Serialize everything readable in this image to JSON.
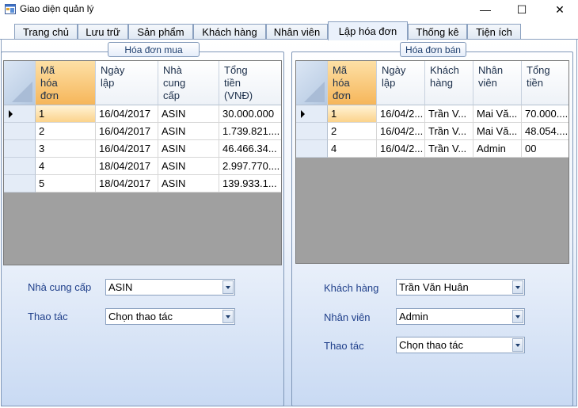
{
  "window": {
    "title": "Giao diện quản lý",
    "minimize": "—",
    "maximize": "☐",
    "close": "✕"
  },
  "tabs": [
    {
      "label": "Trang chủ",
      "active": false
    },
    {
      "label": "Lưu trữ",
      "active": false
    },
    {
      "label": "Sản phẩm",
      "active": false
    },
    {
      "label": "Khách hàng",
      "active": false
    },
    {
      "label": "Nhân viên",
      "active": false
    },
    {
      "label": "Lập hóa đơn",
      "active": true
    },
    {
      "label": "Thống kê",
      "active": false
    },
    {
      "label": "Tiện ích",
      "active": false
    }
  ],
  "purchase": {
    "group_title": "Hóa đơn mua",
    "columns": [
      "Mã\nhóa\nđơn",
      "Ngày\nlập",
      "Nhà\ncung\ncấp",
      "Tổng\ntiền\n(VNĐ)"
    ],
    "rows": [
      [
        "1",
        "16/04/2017",
        "ASIN",
        "30.000.000"
      ],
      [
        "2",
        "16/04/2017",
        "ASIN",
        "1.739.821...."
      ],
      [
        "3",
        "16/04/2017",
        "ASIN",
        "46.466.34..."
      ],
      [
        "4",
        "18/04/2017",
        "ASIN",
        "2.997.770...."
      ],
      [
        "5",
        "18/04/2017",
        "ASIN",
        "139.933.1..."
      ]
    ],
    "supplier_label": "Nhà cung cấp",
    "supplier_value": "ASIN",
    "action_label": "Thao tác",
    "action_value": "Chọn thao tác"
  },
  "sales": {
    "group_title": "Hóa đơn bán",
    "columns": [
      "Mã\nhóa\nđơn",
      "Ngày\nlập",
      "Khách\nhàng",
      "Nhân\nviên",
      "Tổng\ntiền"
    ],
    "rows": [
      [
        "1",
        "16/04/2...",
        "Trần V...",
        "Mai Vă...",
        "70.000...."
      ],
      [
        "2",
        "16/04/2...",
        "Trần V...",
        "Mai Vă...",
        "48.054...."
      ],
      [
        "4",
        "16/04/2...",
        "Trần V...",
        "Admin",
        "00"
      ]
    ],
    "customer_label": "Khách hàng",
    "customer_value": "Trần Văn Huân",
    "employee_label": "Nhân viên",
    "employee_value": "Admin",
    "action_label": "Thao tác",
    "action_value": "Chọn thao tác"
  },
  "colors": {
    "sorted_header": "#f6b65a",
    "label_text": "#1f3f8a",
    "grid_empty": "#a0a0a0"
  }
}
